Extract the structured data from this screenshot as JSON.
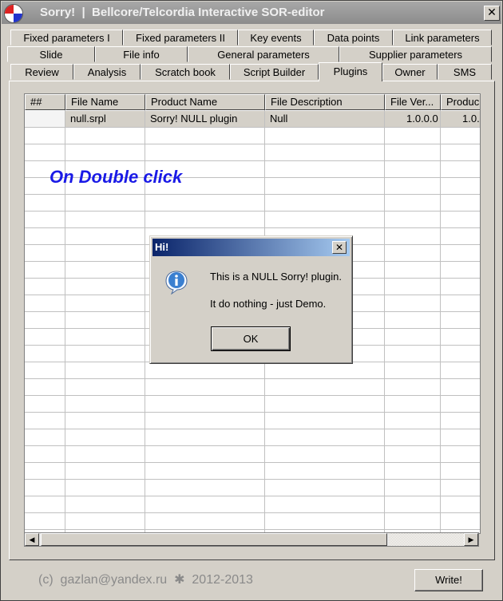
{
  "window": {
    "title": "Sorry!  |  Bellcore/Telcordia Interactive SOR-editor",
    "close_glyph": "✕"
  },
  "tabs": {
    "row1": [
      {
        "label": "Fixed parameters I"
      },
      {
        "label": "Fixed parameters II"
      },
      {
        "label": "Key events"
      },
      {
        "label": "Data points"
      },
      {
        "label": "Link parameters"
      }
    ],
    "row2": [
      {
        "label": "Slide"
      },
      {
        "label": "File info"
      },
      {
        "label": "General parameters"
      },
      {
        "label": "Supplier parameters"
      }
    ],
    "row3": [
      {
        "label": "Review"
      },
      {
        "label": "Analysis"
      },
      {
        "label": "Scratch book"
      },
      {
        "label": "Script Builder"
      },
      {
        "label": "Plugins"
      },
      {
        "label": "Owner"
      },
      {
        "label": "SMS"
      }
    ],
    "active": "Plugins"
  },
  "grid": {
    "columns": [
      "##",
      "File  Name",
      "Product Name",
      "File Description",
      "File Ver...",
      "Produc"
    ],
    "rows": [
      {
        "num": "",
        "file_name": "null.srpl",
        "product_name": "Sorry! NULL plugin",
        "file_description": "Null",
        "file_version": "1.0.0.0",
        "product_version": "1.0."
      }
    ]
  },
  "annotation": "On Double click",
  "dialog": {
    "title": "Hi!",
    "close_glyph": "✕",
    "message_line1": "This is a NULL Sorry! plugin.",
    "message_line2": "It do nothing - just Demo.",
    "ok_label": "OK",
    "icon": "info-icon"
  },
  "footer": {
    "copyright": "(c)  gazlan@yandex.ru  ✱  2012-2013",
    "write_label": "Write!"
  },
  "scrollbar": {
    "left_arrow": "◀",
    "right_arrow": "▶"
  }
}
